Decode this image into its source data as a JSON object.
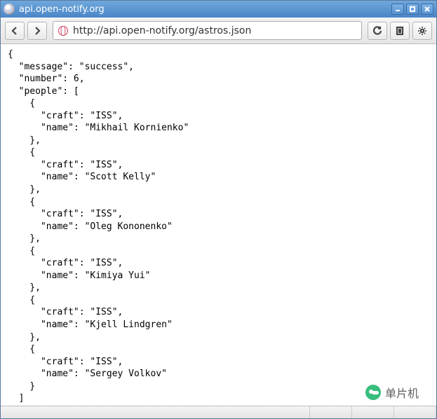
{
  "window": {
    "title": "api.open-notify.org"
  },
  "toolbar": {
    "url": "http://api.open-notify.org/astros.json"
  },
  "api_response": {
    "message": "success",
    "number": 6,
    "people": [
      {
        "craft": "ISS",
        "name": "Mikhail Kornienko"
      },
      {
        "craft": "ISS",
        "name": "Scott Kelly"
      },
      {
        "craft": "ISS",
        "name": "Oleg Kononenko"
      },
      {
        "craft": "ISS",
        "name": "Kimiya Yui"
      },
      {
        "craft": "ISS",
        "name": "Kjell Lindgren"
      },
      {
        "craft": "ISS",
        "name": "Sergey Volkov"
      }
    ]
  },
  "watermark": {
    "label": "单片机"
  }
}
